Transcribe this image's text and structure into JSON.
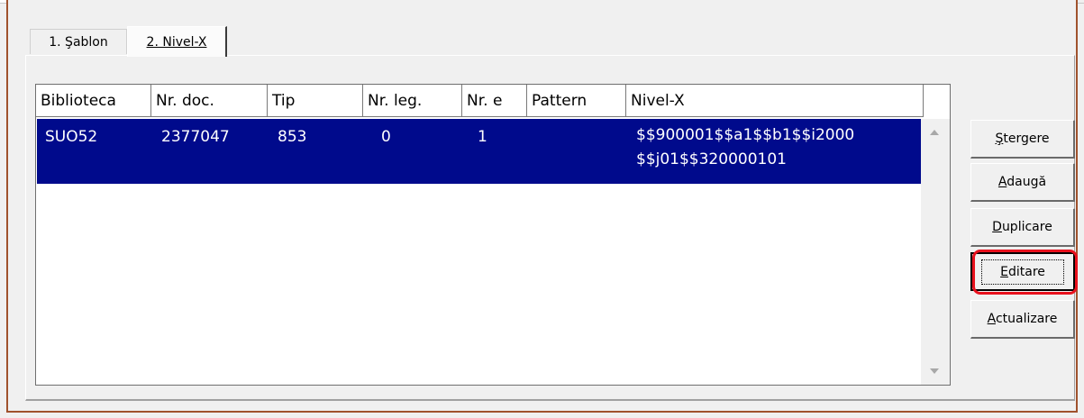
{
  "tabs": [
    {
      "label": "1. Şablon",
      "active": false
    },
    {
      "label": "2. Nivel-X",
      "active": true
    }
  ],
  "table": {
    "columns": [
      "Biblioteca",
      "Nr. doc.",
      "Tip",
      "Nr. leg.",
      "Nr. e",
      "Pattern",
      "Nivel-X"
    ],
    "rows": [
      {
        "biblioteca": "SUO52",
        "nr_doc": "2377047",
        "tip": "853",
        "nr_leg": "0",
        "nr_e": "1",
        "pattern": "",
        "nivel_x_line1": "$$900001$$a1$$b1$$i2000",
        "nivel_x_line2": "$$j01$$320000101",
        "selected": true
      }
    ]
  },
  "buttons": {
    "stergere": {
      "prefix": "",
      "accel": "Ş",
      "rest": "tergere"
    },
    "adauga": {
      "prefix": "",
      "accel": "A",
      "rest": "daugă"
    },
    "duplicare": {
      "prefix": "",
      "accel": "D",
      "rest": "uplicare"
    },
    "editare": {
      "prefix": "",
      "accel": "E",
      "rest": "ditare"
    },
    "actualizare": {
      "prefix": "",
      "accel": "A",
      "rest": "ctualizare"
    }
  },
  "colors": {
    "selection": "#000a8c",
    "highlight": "#e8101c",
    "frame": "#a0522d"
  }
}
